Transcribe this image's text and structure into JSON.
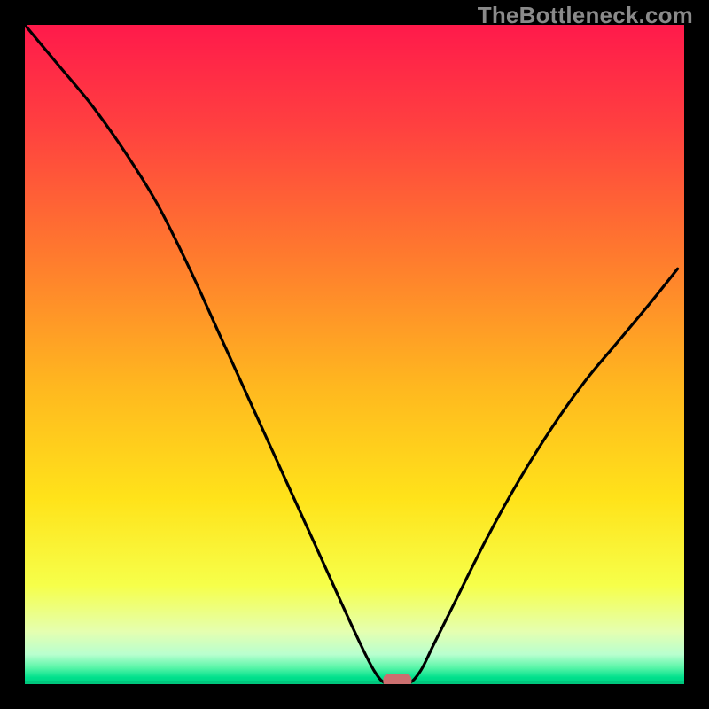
{
  "watermark": "TheBottleneck.com",
  "chart_data": {
    "type": "line",
    "title": "",
    "xlabel": "",
    "ylabel": "",
    "xlim": [
      0,
      100
    ],
    "ylim": [
      0,
      100
    ],
    "grid": false,
    "legend": false,
    "series": [
      {
        "name": "curve",
        "x": [
          0,
          5,
          10,
          15,
          20,
          25,
          30,
          35,
          40,
          45,
          50,
          53,
          55,
          58,
          60,
          62,
          65,
          70,
          75,
          80,
          85,
          90,
          95,
          99
        ],
        "y": [
          100,
          94,
          88,
          81,
          73,
          63,
          52,
          41,
          30,
          19,
          8,
          2,
          0,
          0,
          2,
          6,
          12,
          22,
          31,
          39,
          46,
          52,
          58,
          63
        ]
      }
    ],
    "marker": {
      "x": 56.5,
      "y": 0,
      "label": "optimal-point"
    },
    "axis_line_y": 0,
    "background_gradient": {
      "stops": [
        {
          "offset": 0.0,
          "color": "#ff1a4b"
        },
        {
          "offset": 0.15,
          "color": "#ff3f40"
        },
        {
          "offset": 0.35,
          "color": "#ff7a2e"
        },
        {
          "offset": 0.55,
          "color": "#ffb81f"
        },
        {
          "offset": 0.72,
          "color": "#ffe31a"
        },
        {
          "offset": 0.85,
          "color": "#f6ff4a"
        },
        {
          "offset": 0.92,
          "color": "#e5ffb0"
        },
        {
          "offset": 0.955,
          "color": "#b8ffcf"
        },
        {
          "offset": 0.975,
          "color": "#58f5a8"
        },
        {
          "offset": 0.99,
          "color": "#00e08c"
        },
        {
          "offset": 1.0,
          "color": "#00d084"
        }
      ]
    }
  }
}
